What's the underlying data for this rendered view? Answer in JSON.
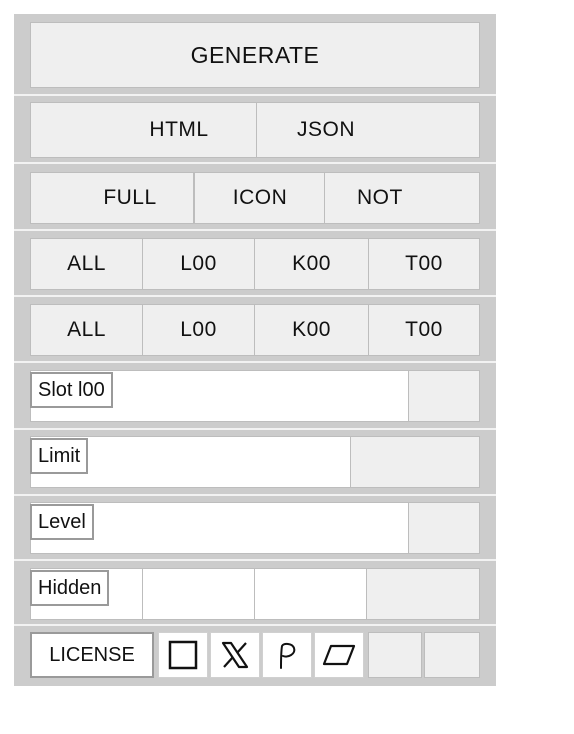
{
  "generate": {
    "label": "GENERATE"
  },
  "format": {
    "options": [
      "HTML",
      "JSON"
    ]
  },
  "mode": {
    "options": [
      "FULL",
      "ICON",
      "NOT"
    ]
  },
  "filter_a": {
    "options": [
      "ALL",
      "L00",
      "K00",
      "T00"
    ]
  },
  "filter_b": {
    "options": [
      "ALL",
      "L00",
      "K00",
      "T00"
    ]
  },
  "slot": {
    "label": "Slot l00",
    "value": ""
  },
  "limit": {
    "label": "Limit",
    "value": ""
  },
  "level": {
    "label": "Level",
    "value": ""
  },
  "hidden": {
    "label": "Hidden"
  },
  "footer": {
    "license_label": "LICENSE",
    "icons": [
      "square-icon",
      "x-logo-icon",
      "p-script-icon",
      "parallelogram-icon"
    ]
  }
}
